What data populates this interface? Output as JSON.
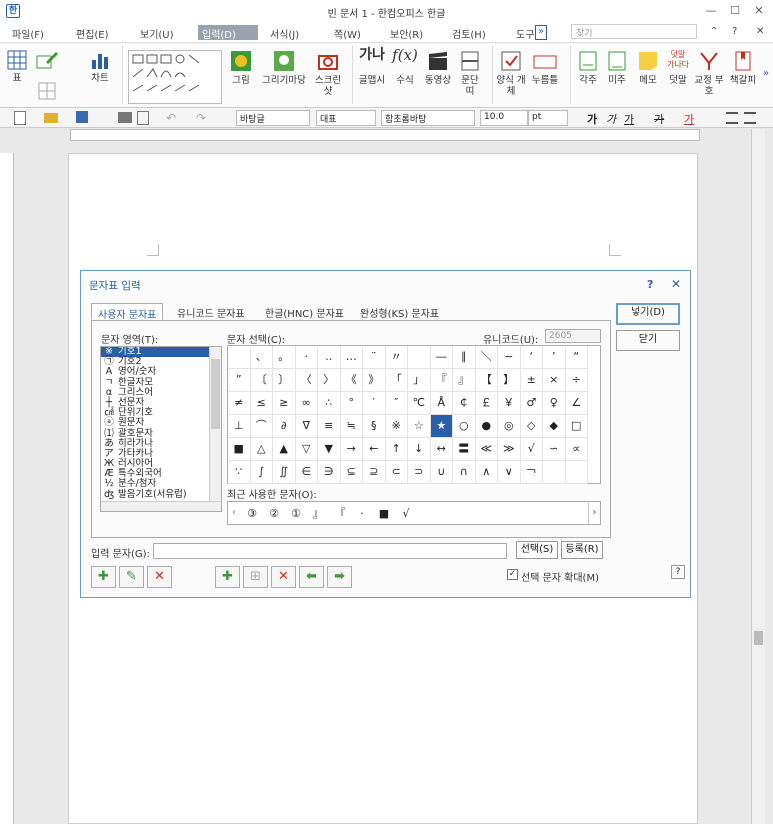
{
  "window": {
    "title": "빈 문서 1 - 한컴오피스 한글",
    "app_icon": "한",
    "minimize": "—",
    "restore": "☐",
    "close": "✕"
  },
  "menu": {
    "items": [
      "파일(F)",
      "편집(E)",
      "보기(U)",
      "입력(D)",
      "서식(J)",
      "쪽(W)",
      "보안(R)",
      "검토(H)",
      "도구"
    ],
    "active_index": 3,
    "search_placeholder": "찾기",
    "overflow": "»",
    "help": "?",
    "collapse": "⌃"
  },
  "ribbon": {
    "table": "표",
    "chart": "차트",
    "picture": "그림",
    "drawing_mart": "그리기마당",
    "screenshot": "스크린샷",
    "font_art": "글맵시",
    "formula": "수식",
    "video": "동영상",
    "paragraph": "문단띠",
    "form_object": "양식 개체",
    "button": "누름틀",
    "footnote": "각주",
    "endnote": "미주",
    "memo": "메모",
    "comment": "덧말",
    "proofread": "교정 부호",
    "bookmark": "책갈피"
  },
  "toolbar": {
    "style": "바탕글",
    "lang": "대표",
    "font": "함초롬바탕",
    "size": "10.0",
    "unit": "pt",
    "bold": "가",
    "italic": "가",
    "underline": "가",
    "strike": "가",
    "color": "가"
  },
  "dialog": {
    "title": "문자표 입력",
    "help": "?",
    "close": "✕",
    "tabs": [
      "사용자 문자표",
      "유니코드 문자표",
      "한글(HNC) 문자표",
      "완성형(KS) 문자표"
    ],
    "selected_tab": 0,
    "area_label": "문자 영역(T):",
    "select_label": "문자 선택(C):",
    "unicode_label": "유니코드(U):",
    "unicode_value": "2605",
    "areas": [
      {
        "glyph": "※",
        "name": "기호1"
      },
      {
        "glyph": "㉠",
        "name": "기호2"
      },
      {
        "glyph": "A",
        "name": "영어/숫자"
      },
      {
        "glyph": "ㄱ",
        "name": "한글자모"
      },
      {
        "glyph": "α",
        "name": "그리스어"
      },
      {
        "glyph": "┼",
        "name": "선문자"
      },
      {
        "glyph": "㎠",
        "name": "단위기호"
      },
      {
        "glyph": "ⓐ",
        "name": "원문자"
      },
      {
        "glyph": "⑴",
        "name": "괄호문자"
      },
      {
        "glyph": "あ",
        "name": "히라가나"
      },
      {
        "glyph": "ア",
        "name": "가타카나"
      },
      {
        "glyph": "Ж",
        "name": "러시아어"
      },
      {
        "glyph": "Æ",
        "name": "특수외국어"
      },
      {
        "glyph": "½",
        "name": "분수/첨자"
      },
      {
        "glyph": "ʤ",
        "name": "발음기호(서유럽)"
      }
    ],
    "selected_area": 0,
    "chars": [
      "",
      "、",
      "。",
      "·",
      "‥",
      "…",
      "¨",
      "〃",
      "­",
      "―",
      "∥",
      "＼",
      "∼",
      "‘",
      "’",
      "“",
      "”",
      "〔",
      "〕",
      "〈",
      "〉",
      "《",
      "》",
      "「",
      "」",
      "『",
      "』",
      "【",
      "】",
      "±",
      "×",
      "÷",
      "≠",
      "≤",
      "≥",
      "∞",
      "∴",
      "°",
      "′",
      "″",
      "℃",
      "Å",
      "￠",
      "￡",
      "￥",
      "♂",
      "♀",
      "∠",
      "⊥",
      "⌒",
      "∂",
      "∇",
      "≡",
      "≒",
      "§",
      "※",
      "☆",
      "★",
      "○",
      "●",
      "◎",
      "◇",
      "◆",
      "□",
      "■",
      "△",
      "▲",
      "▽",
      "▼",
      "→",
      "←",
      "↑",
      "↓",
      "↔",
      "〓",
      "≪",
      "≫",
      "√",
      "∽",
      "∝",
      "∵",
      "∫",
      "∬",
      "∈",
      "∋",
      "⊆",
      "⊇",
      "⊂",
      "⊃",
      "∪",
      "∩",
      "∧",
      "∨",
      "￢",
      "",
      ""
    ],
    "selected_char": 57,
    "recent_label": "최근 사용한 문자(O):",
    "recent": [
      "③",
      "②",
      "①",
      "』",
      "『",
      "·",
      "■",
      "√"
    ],
    "input_label": "입력 문자(G):",
    "input_value": "",
    "select_btn": "선택(S)",
    "register_btn": "등록(R)",
    "insert_btn": "넣기(D)",
    "close_btn": "닫기",
    "expand_label": "선택 문자 확대(M)",
    "expand_checked": true,
    "help_small": "?",
    "user_icons": [
      "✚",
      "✎",
      "✕"
    ],
    "user_colors": [
      "#3a9a3a",
      "#3a9a3a",
      "#d03020"
    ]
  }
}
